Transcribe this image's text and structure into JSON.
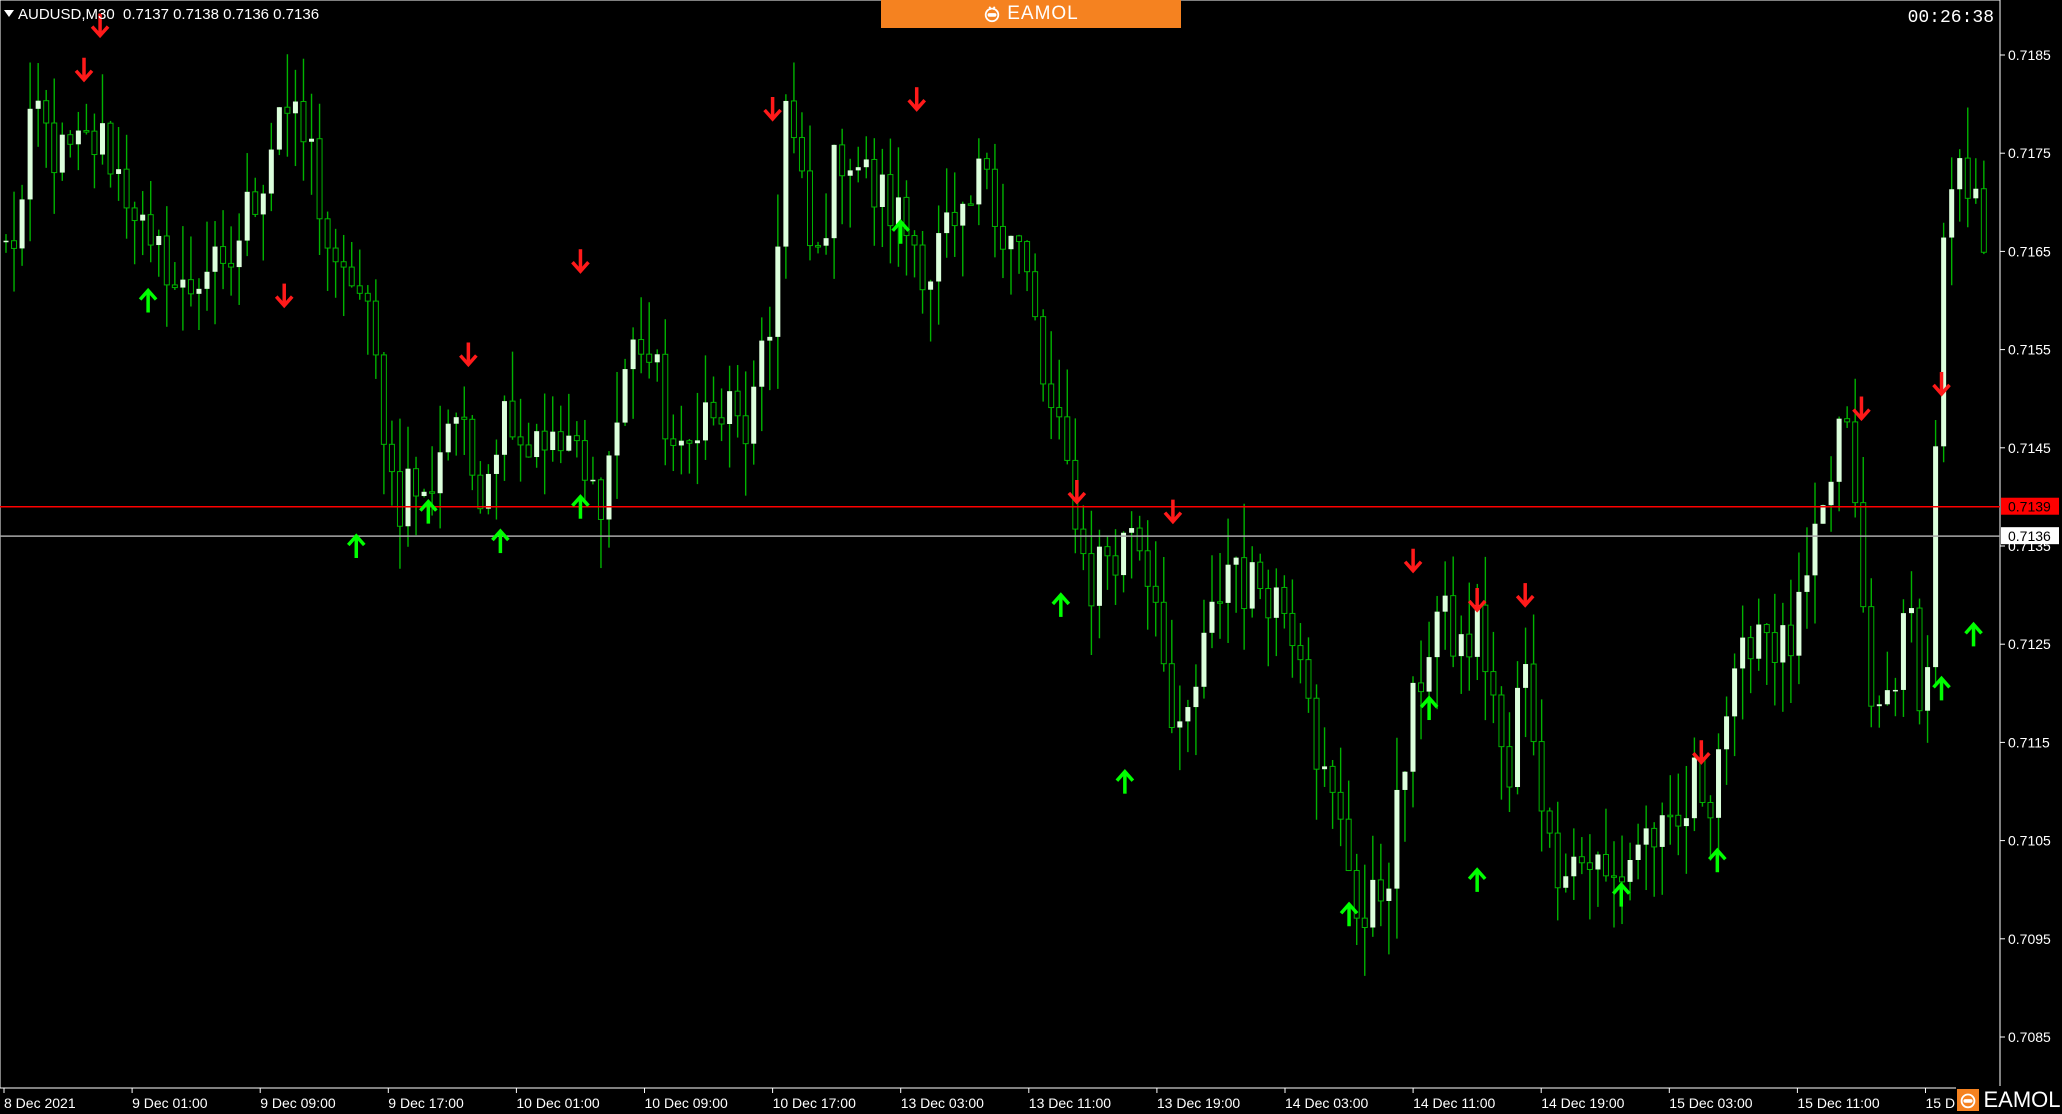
{
  "header": {
    "symbol": "AUDUSD,M30",
    "ohlc": "0.7137 0.7138 0.7136 0.7136"
  },
  "clock": "00:26:38",
  "brand": {
    "name": "EAMOL",
    "color": "#f58220"
  },
  "colors": {
    "background": "#000000",
    "candle": "#00b300",
    "candle_body_up": "#dcffdc",
    "arrow_up": "#00ff00",
    "arrow_down": "#ff1a1a",
    "bid_line": "#ff0000",
    "ask_line": "#a8a8a8",
    "axis": "#ffffff"
  },
  "chart_data": {
    "type": "candlestick",
    "symbol": "AUDUSD",
    "timeframe": "M30",
    "ylim": [
      0.708,
      0.719
    ],
    "y_ticks": [
      "0.7185",
      "0.7175",
      "0.7165",
      "0.7155",
      "0.7145",
      "0.7135",
      "0.7125",
      "0.7115",
      "0.7105",
      "0.7095",
      "0.7085"
    ],
    "x_ticks": [
      "8 Dec 2021",
      "9 Dec 01:00",
      "9 Dec 09:00",
      "9 Dec 17:00",
      "10 Dec 01:00",
      "10 Dec 09:00",
      "10 Dec 17:00",
      "13 Dec 03:00",
      "13 Dec 11:00",
      "13 Dec 19:00",
      "14 Dec 03:00",
      "14 Dec 11:00",
      "14 Dec 19:00",
      "15 Dec 03:00",
      "15 Dec 11:00",
      "15 D"
    ],
    "bid_line": {
      "value": 0.7139,
      "label": "0.7139"
    },
    "ask_line": {
      "value": 0.7136,
      "label": "0.7136"
    },
    "price_path": [
      0.7165,
      0.7168,
      0.718,
      0.7176,
      0.7174,
      0.7175,
      0.7176,
      0.7176,
      0.7172,
      0.717,
      0.7163,
      0.7165,
      0.716,
      0.7162,
      0.7164,
      0.7161,
      0.7166,
      0.717,
      0.7174,
      0.7181,
      0.7177,
      0.7176,
      0.7168,
      0.716,
      0.7163,
      0.7158,
      0.715,
      0.7139,
      0.7142,
      0.7139,
      0.7145,
      0.715,
      0.7143,
      0.7142,
      0.7147,
      0.715,
      0.7145,
      0.7148,
      0.7144,
      0.7146,
      0.7141,
      0.714,
      0.7145,
      0.7154,
      0.7156,
      0.7152,
      0.7146,
      0.7142,
      0.715,
      0.7147,
      0.7149,
      0.7146,
      0.715,
      0.7157,
      0.718,
      0.7172,
      0.7162,
      0.7171,
      0.7176,
      0.7174,
      0.7171,
      0.717,
      0.7168,
      0.7166,
      0.7163,
      0.7167,
      0.7165,
      0.717,
      0.7175,
      0.7167,
      0.7166,
      0.716,
      0.715,
      0.7145,
      0.714,
      0.713,
      0.7135,
      0.7133,
      0.7138,
      0.7133,
      0.7129,
      0.7112,
      0.7118,
      0.7124,
      0.713,
      0.7135,
      0.713,
      0.7132,
      0.713,
      0.7128,
      0.7125,
      0.7112,
      0.7108,
      0.7103,
      0.7096,
      0.7099,
      0.7104,
      0.7114,
      0.7122,
      0.7128,
      0.7126,
      0.7124,
      0.7127,
      0.712,
      0.7108,
      0.7124,
      0.7115,
      0.7103,
      0.7104,
      0.7103,
      0.7103,
      0.71,
      0.7102,
      0.7105,
      0.7106,
      0.7104,
      0.7106,
      0.7111,
      0.711,
      0.7118,
      0.712,
      0.7128,
      0.7127,
      0.7124,
      0.7126,
      0.7132,
      0.7138,
      0.7147,
      0.7143,
      0.7118,
      0.7118,
      0.7124,
      0.7127,
      0.7117,
      0.7162,
      0.7172,
      0.717,
      0.7167
    ],
    "down_arrows": [
      {
        "date": "8 Dec 2021",
        "price": 0.71835
      },
      {
        "date": "8 Dec 23:00",
        "price": 0.7188
      },
      {
        "date": "9 Dec 10:30",
        "price": 0.71605
      },
      {
        "date": "9 Dec 22:00",
        "price": 0.71545
      },
      {
        "date": "10 Dec 05:00",
        "price": 0.7164
      },
      {
        "date": "10 Dec 17:00",
        "price": 0.71795
      },
      {
        "date": "13 Dec 02:00",
        "price": 0.71805
      },
      {
        "date": "13 Dec 12:00",
        "price": 0.71405
      },
      {
        "date": "13 Dec 18:00",
        "price": 0.71385
      },
      {
        "date": "14 Dec 09:00",
        "price": 0.71335
      },
      {
        "date": "14 Dec 13:00",
        "price": 0.71295
      },
      {
        "date": "14 Dec 16:00",
        "price": 0.713
      },
      {
        "date": "15 Dec 03:00",
        "price": 0.7114
      },
      {
        "date": "15 Dec 13:00",
        "price": 0.7149
      },
      {
        "date": "15 Dec 18:00",
        "price": 0.71515
      }
    ],
    "up_arrows": [
      {
        "date": "9 Dec 02:00",
        "price": 0.716
      },
      {
        "date": "9 Dec 15:00",
        "price": 0.7135
      },
      {
        "date": "9 Dec 19:30",
        "price": 0.71385
      },
      {
        "date": "10 Dec 00:00",
        "price": 0.71355
      },
      {
        "date": "10 Dec 05:00",
        "price": 0.7139
      },
      {
        "date": "13 Dec 01:00",
        "price": 0.7167
      },
      {
        "date": "13 Dec 11:00",
        "price": 0.7129
      },
      {
        "date": "13 Dec 15:00",
        "price": 0.7111
      },
      {
        "date": "14 Dec 05:00",
        "price": 0.70975
      },
      {
        "date": "14 Dec 10:00",
        "price": 0.71185
      },
      {
        "date": "14 Dec 13:00",
        "price": 0.7101
      },
      {
        "date": "14 Dec 22:00",
        "price": 0.70995
      },
      {
        "date": "15 Dec 04:00",
        "price": 0.7103
      },
      {
        "date": "15 Dec 18:00",
        "price": 0.71205
      },
      {
        "date": "15 Dec 20:00",
        "price": 0.7126
      }
    ]
  }
}
